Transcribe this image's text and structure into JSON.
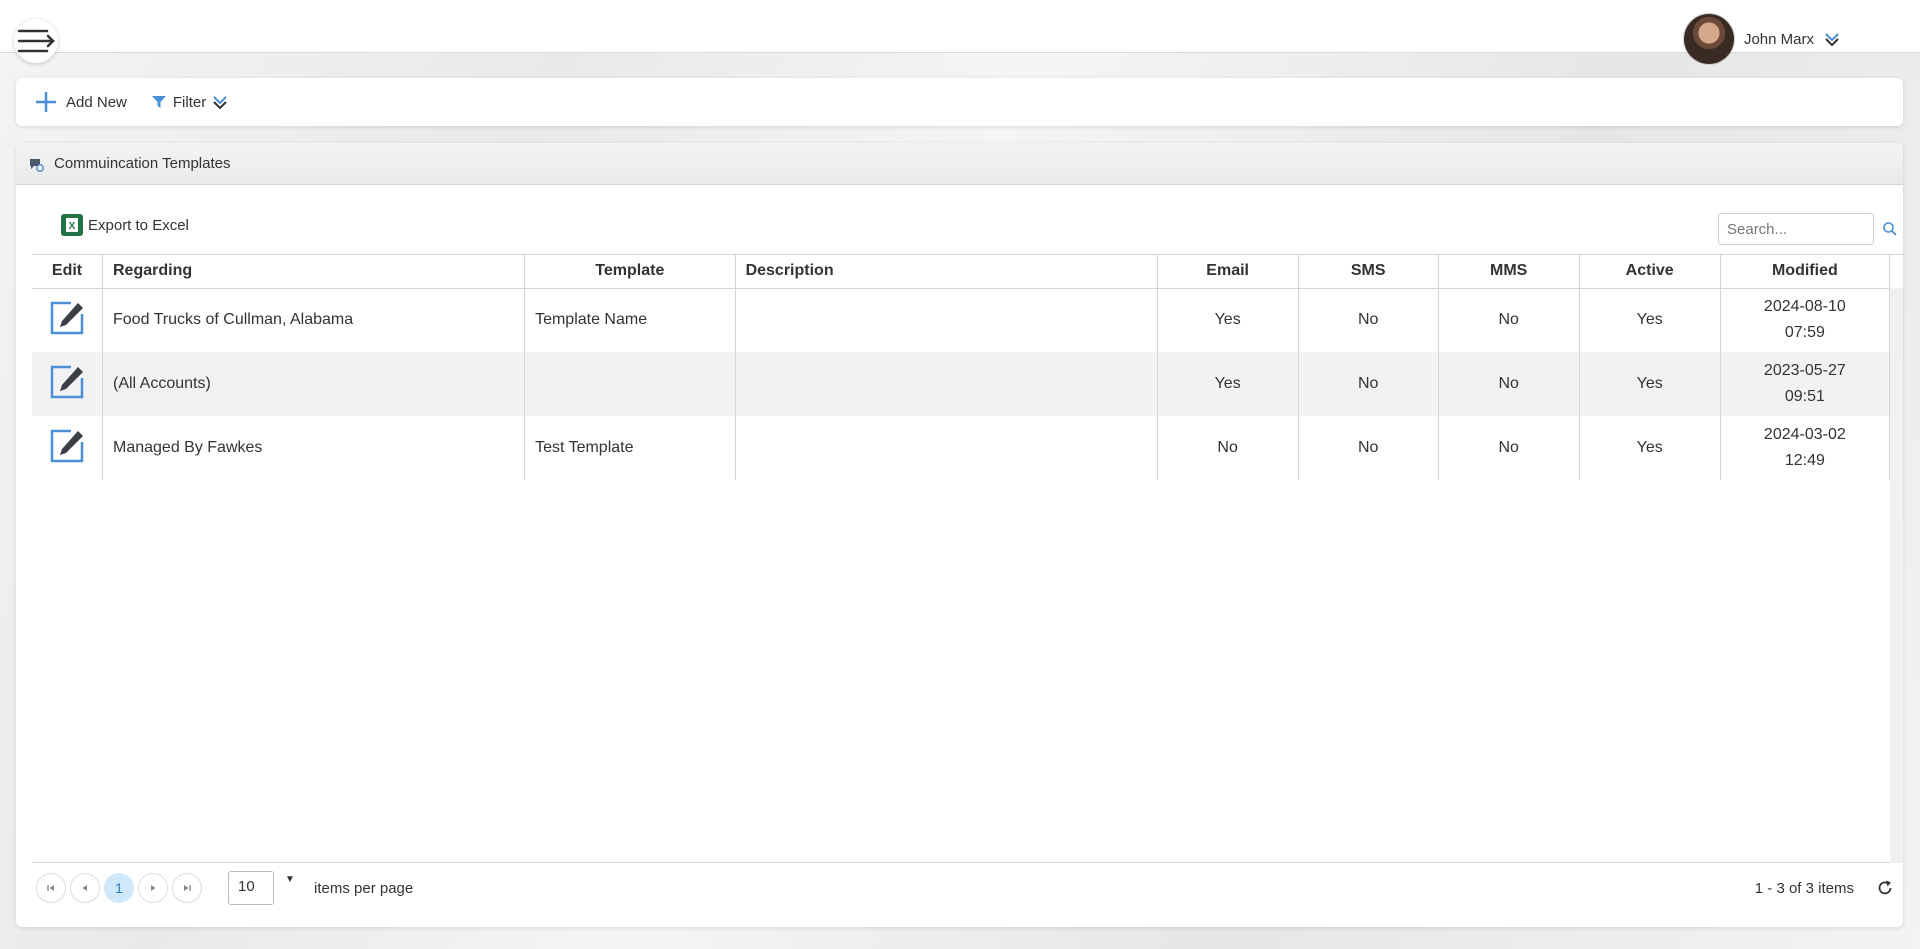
{
  "header": {
    "user_name": "John Marx",
    "menu_icon": "hamburger-arrow-icon",
    "user_caret_icon": "double-chevron-down-icon"
  },
  "toolbar": {
    "add_new_label": "Add New",
    "filter_label": "Filter"
  },
  "panel": {
    "title": "Commuincation Templates"
  },
  "grid": {
    "export_label": "Export to Excel",
    "search_placeholder": "Search...",
    "columns": [
      "Edit",
      "Regarding",
      "Template",
      "Description",
      "Email",
      "SMS",
      "MMS",
      "Active",
      "Modified"
    ],
    "rows": [
      {
        "regarding": "Food Trucks of Cullman, Alabama",
        "template": "Template Name",
        "description": "",
        "email": "Yes",
        "sms": "No",
        "mms": "No",
        "active": "Yes",
        "modified_date": "2024-08-10",
        "modified_time": "07:59"
      },
      {
        "regarding": "(All Accounts)",
        "template": "",
        "description": "",
        "email": "Yes",
        "sms": "No",
        "mms": "No",
        "active": "Yes",
        "modified_date": "2023-05-27",
        "modified_time": "09:51"
      },
      {
        "regarding": "Managed By Fawkes",
        "template": "Test Template",
        "description": "",
        "email": "No",
        "sms": "No",
        "mms": "No",
        "active": "Yes",
        "modified_date": "2024-03-02",
        "modified_time": "12:49"
      }
    ]
  },
  "pager": {
    "current_page": "1",
    "page_size": "10",
    "items_per_page_label": "items per page",
    "info": "1 - 3 of 3 items"
  },
  "colors": {
    "accent_blue": "#4a90d9",
    "excel_green": "#217346",
    "active_page_bg": "#cfe8fb"
  }
}
